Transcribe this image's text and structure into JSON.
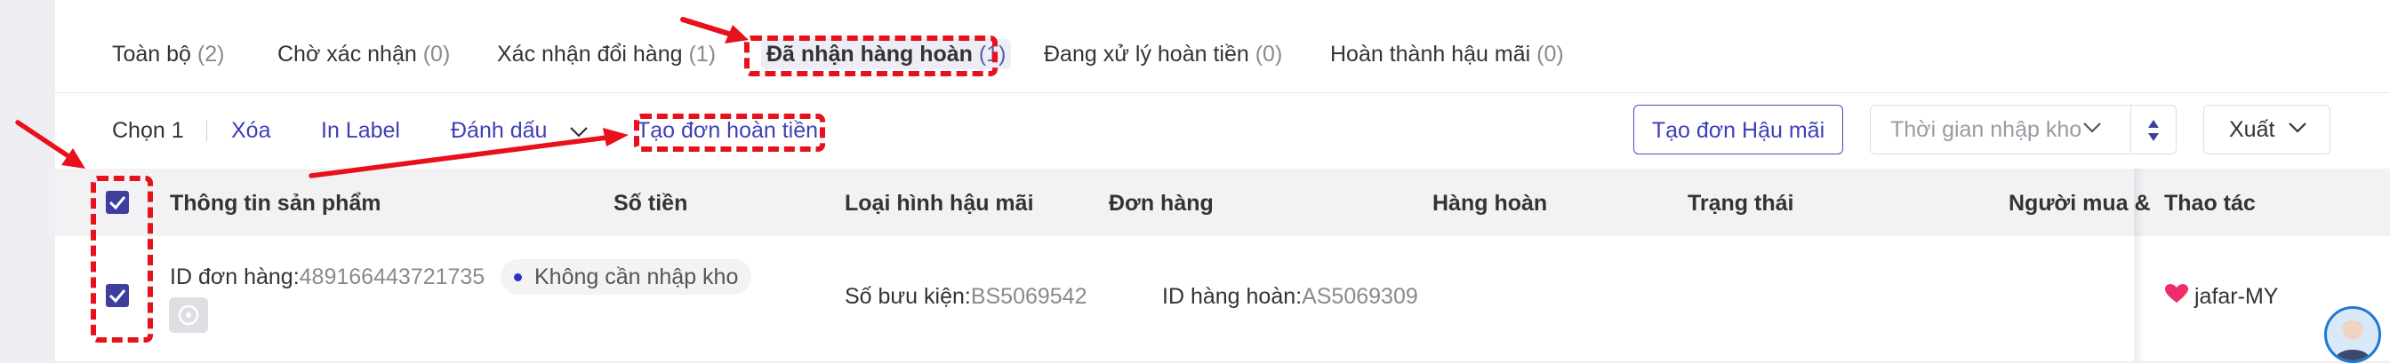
{
  "tabs": [
    {
      "label": "Toàn bộ",
      "count": "(2)"
    },
    {
      "label": "Chờ xác nhận",
      "count": "(0)"
    },
    {
      "label": "Xác nhận đổi hàng",
      "count": "(1)"
    },
    {
      "label": "Đã nhận hàng hoàn",
      "count": "(1)",
      "active": true
    },
    {
      "label": "Đang xử lý hoàn tiền",
      "count": "(0)"
    },
    {
      "label": "Hoàn thành hậu mãi",
      "count": "(0)"
    }
  ],
  "toolbar": {
    "selected": "Chọn 1",
    "delete": "Xóa",
    "print_label": "In Label",
    "mark": "Đánh dấu",
    "create_refund": "Tạo đơn hoàn tiền",
    "create_aftersale": "Tạo đơn Hậu mãi",
    "time_select_placeholder": "Thời gian nhập kho",
    "export": "Xuất"
  },
  "table": {
    "headers": [
      "Thông tin sản phẩm",
      "Số tiền",
      "Loại hình hậu mãi",
      "Đơn hàng",
      "Hàng hoàn",
      "Trạng thái",
      "Người mua &",
      "Thao tác"
    ],
    "rows": [
      {
        "order_id_label": "ID đơn hàng:",
        "order_id": "489166443721735",
        "warehouse_status": "Không cần nhập kho",
        "tracking_label": "Số bưu kiện:",
        "tracking": "BS5069542",
        "return_id_label": "ID hàng hoàn:",
        "return_id": "AS5069309",
        "buyer": "jafar-MY"
      }
    ]
  },
  "colors": {
    "accent": "#3e3e9f",
    "annotation": "#e8101a",
    "link": "#3f3fb8"
  }
}
